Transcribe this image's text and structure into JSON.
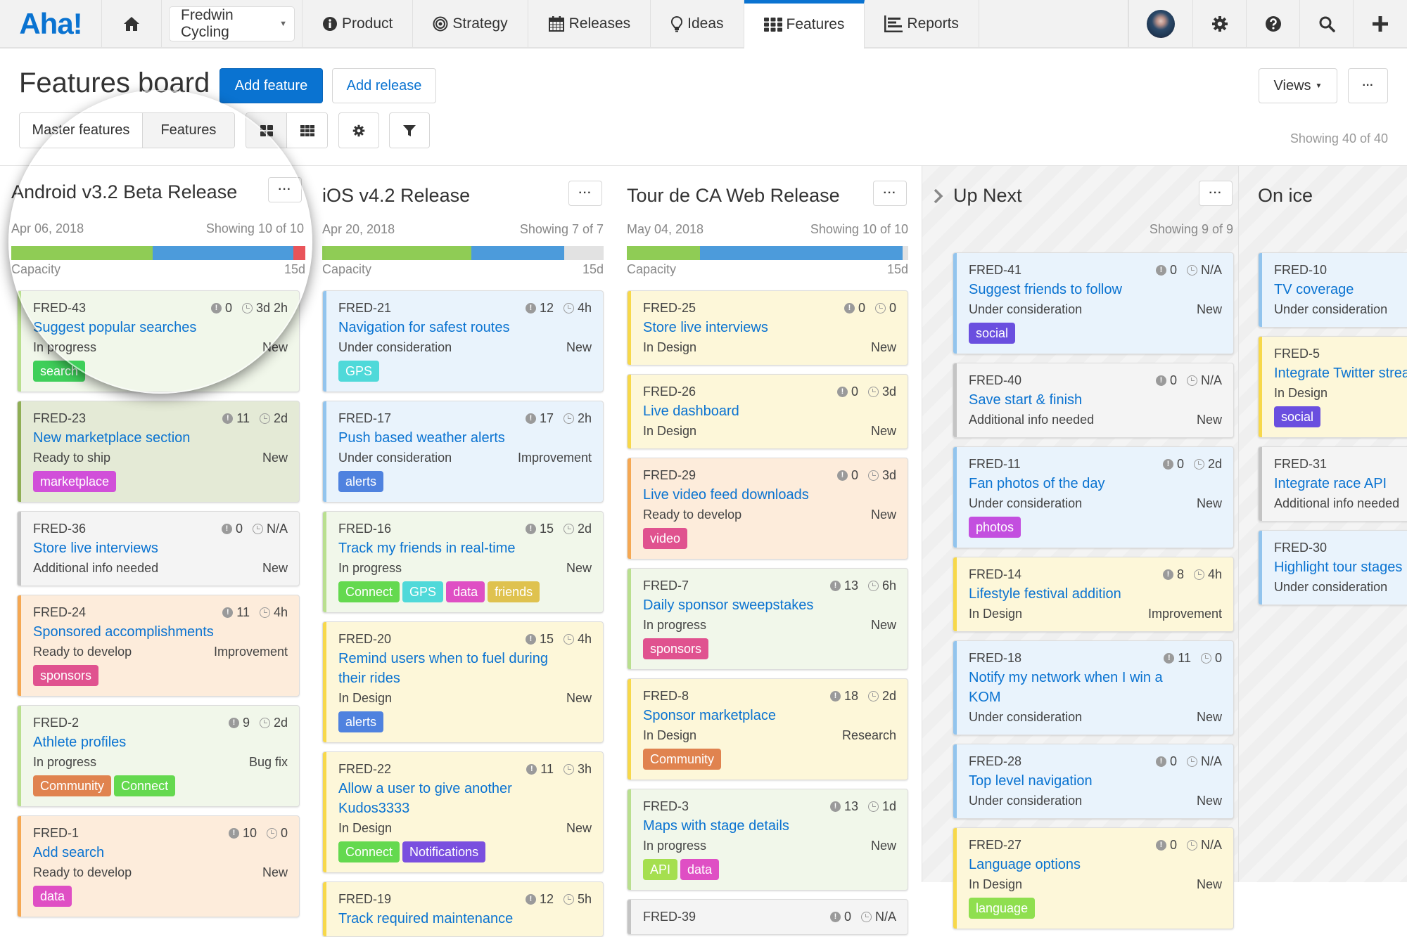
{
  "nav": {
    "logo": "Aha!",
    "product_select": "Fredwin Cycling",
    "tabs": [
      {
        "label": "Product",
        "icon": "info-circle-icon"
      },
      {
        "label": "Strategy",
        "icon": "target-icon"
      },
      {
        "label": "Releases",
        "icon": "calendar-icon"
      },
      {
        "label": "Ideas",
        "icon": "lightbulb-icon"
      },
      {
        "label": "Features",
        "icon": "grid-icon",
        "active": true
      },
      {
        "label": "Reports",
        "icon": "report-icon"
      }
    ]
  },
  "header": {
    "title": "Features board",
    "add_feature": "Add feature",
    "add_release": "Add release",
    "views": "Views",
    "more": "···",
    "toggle": [
      "Master features",
      "Features"
    ],
    "showing": "Showing 40 of 40"
  },
  "colors": {
    "accent": "#0a73d1",
    "capacity_done": "#8fcc55",
    "capacity_planned": "#4c9bdb",
    "capacity_over": "#e9545a"
  },
  "columns": [
    {
      "title": "Android v3.2 Beta Release",
      "date": "Apr 06, 2018",
      "showing": "Showing 10 of 10",
      "capacity_label": "Capacity",
      "capacity_value": "15d",
      "capacity": {
        "done": 0.48,
        "planned": 0.48,
        "over": 0.04
      },
      "cards": [
        {
          "id": "FRED-43",
          "title": [
            "Suggest popular searches"
          ],
          "status": "In progress",
          "type": "New",
          "score": "0",
          "time": "3d 2h",
          "color": "green",
          "tags": [
            {
              "label": "search",
              "color": "#3fcf5a"
            }
          ]
        },
        {
          "id": "FRED-23",
          "title": [
            "New marketplace section"
          ],
          "status": "Ready to ship",
          "type": "New",
          "score": "11",
          "time": "2d",
          "color": "olive",
          "tags": [
            {
              "label": "marketplace",
              "color": "#d14fd9"
            }
          ]
        },
        {
          "id": "FRED-36",
          "title": [
            "Store live interviews"
          ],
          "status": "Additional info needed",
          "type": "New",
          "score": "0",
          "time": "N/A",
          "color": "gray",
          "tags": []
        },
        {
          "id": "FRED-24",
          "title": [
            "Sponsored accomplishments"
          ],
          "status": "Ready to develop",
          "type": "Improvement",
          "score": "11",
          "time": "4h",
          "color": "orange",
          "tags": [
            {
              "label": "sponsors",
              "color": "#e0528f"
            }
          ]
        },
        {
          "id": "FRED-2",
          "title": [
            "Athlete profiles"
          ],
          "status": "In progress",
          "type": "Bug fix",
          "score": "9",
          "time": "2d",
          "color": "green",
          "tags": [
            {
              "label": "Community",
              "color": "#e0834f"
            },
            {
              "label": "Connect",
              "color": "#64d94f"
            }
          ]
        },
        {
          "id": "FRED-1",
          "title": [
            "Add search"
          ],
          "status": "Ready to develop",
          "type": "New",
          "score": "10",
          "time": "0",
          "color": "orange",
          "tags": [
            {
              "label": "data",
              "color": "#df4fc4"
            }
          ]
        }
      ]
    },
    {
      "title": "iOS v4.2 Release",
      "date": "Apr 20, 2018",
      "showing": "Showing 7 of 7",
      "capacity_label": "Capacity",
      "capacity_value": "15d",
      "capacity": {
        "done": 0.53,
        "planned": 0.33,
        "over": 0
      },
      "cards": [
        {
          "id": "FRED-21",
          "title": [
            "Navigation for safest routes"
          ],
          "status": "Under consideration",
          "type": "New",
          "score": "12",
          "time": "4h",
          "color": "blue",
          "tags": [
            {
              "label": "GPS",
              "color": "#4fd9d9"
            }
          ]
        },
        {
          "id": "FRED-17",
          "title": [
            "Push based weather alerts"
          ],
          "status": "Under consideration",
          "type": "Improvement",
          "score": "17",
          "time": "2h",
          "color": "blue",
          "tags": [
            {
              "label": "alerts",
              "color": "#4f82df"
            }
          ]
        },
        {
          "id": "FRED-16",
          "title": [
            "Track my friends in real-time"
          ],
          "status": "In progress",
          "type": "New",
          "score": "15",
          "time": "2d",
          "color": "green",
          "tags": [
            {
              "label": "Connect",
              "color": "#64d94f"
            },
            {
              "label": "GPS",
              "color": "#4fd9d9"
            },
            {
              "label": "data",
              "color": "#df4fc4"
            },
            {
              "label": "friends",
              "color": "#dfc24f"
            }
          ]
        },
        {
          "id": "FRED-20",
          "title": [
            "Remind users when to fuel during",
            "their rides"
          ],
          "status": "In Design",
          "type": "New",
          "score": "15",
          "time": "4h",
          "color": "yellow",
          "tags": [
            {
              "label": "alerts",
              "color": "#4f82df"
            }
          ]
        },
        {
          "id": "FRED-22",
          "title": [
            "Allow a user to give another",
            "Kudos3333"
          ],
          "status": "In Design",
          "type": "New",
          "score": "11",
          "time": "3h",
          "color": "yellow",
          "tags": [
            {
              "label": "Connect",
              "color": "#64d94f"
            },
            {
              "label": "Notifications",
              "color": "#7a4fdf"
            }
          ]
        },
        {
          "id": "FRED-19",
          "title": [
            "Track required maintenance"
          ],
          "status": "",
          "type": "",
          "score": "12",
          "time": "5h",
          "color": "yellow",
          "tags": []
        }
      ]
    },
    {
      "title": "Tour de CA Web Release",
      "date": "May 04, 2018",
      "showing": "Showing 10 of 10",
      "capacity_label": "Capacity",
      "capacity_value": "15d",
      "capacity": {
        "done": 0.26,
        "planned": 0.72,
        "over": 0
      },
      "cards": [
        {
          "id": "FRED-25",
          "title": [
            "Store live interviews"
          ],
          "status": "In Design",
          "type": "New",
          "score": "0",
          "time": "0",
          "color": "yellow",
          "tags": []
        },
        {
          "id": "FRED-26",
          "title": [
            "Live dashboard"
          ],
          "status": "In Design",
          "type": "New",
          "score": "0",
          "time": "3d",
          "color": "yellow",
          "tags": []
        },
        {
          "id": "FRED-29",
          "title": [
            "Live video feed downloads"
          ],
          "status": "Ready to develop",
          "type": "New",
          "score": "0",
          "time": "3d",
          "color": "orange",
          "tags": [
            {
              "label": "video",
              "color": "#e0528f"
            }
          ]
        },
        {
          "id": "FRED-7",
          "title": [
            "Daily sponsor sweepstakes"
          ],
          "status": "In progress",
          "type": "New",
          "score": "13",
          "time": "6h",
          "color": "green",
          "tags": [
            {
              "label": "sponsors",
              "color": "#e0528f"
            }
          ]
        },
        {
          "id": "FRED-8",
          "title": [
            "Sponsor marketplace"
          ],
          "status": "In Design",
          "type": "Research",
          "score": "18",
          "time": "2d",
          "color": "yellow",
          "tags": [
            {
              "label": "Community",
              "color": "#e0834f"
            }
          ]
        },
        {
          "id": "FRED-3",
          "title": [
            "Maps with stage details"
          ],
          "status": "In progress",
          "type": "New",
          "score": "13",
          "time": "1d",
          "color": "green",
          "tags": [
            {
              "label": "API",
              "color": "#a5df4f"
            },
            {
              "label": "data",
              "color": "#df4fc4"
            }
          ]
        },
        {
          "id": "FRED-39",
          "title": [],
          "status": "",
          "type": "",
          "score": "0",
          "time": "N/A",
          "color": "gray",
          "tags": []
        }
      ]
    },
    {
      "title": "Up Next",
      "showing": "Showing 9 of 9",
      "cards": [
        {
          "id": "FRED-41",
          "title": [
            "Suggest friends to follow"
          ],
          "status": "Under consideration",
          "type": "New",
          "score": "0",
          "time": "N/A",
          "color": "blue",
          "tags": [
            {
              "label": "social",
              "color": "#6a4fdf"
            }
          ]
        },
        {
          "id": "FRED-40",
          "title": [
            "Save start & finish"
          ],
          "status": "Additional info needed",
          "type": "New",
          "score": "0",
          "time": "N/A",
          "color": "gray",
          "tags": []
        },
        {
          "id": "FRED-11",
          "title": [
            "Fan photos of the day"
          ],
          "status": "Under consideration",
          "type": "New",
          "score": "0",
          "time": "2d",
          "color": "blue",
          "tags": [
            {
              "label": "photos",
              "color": "#c34fdf"
            }
          ]
        },
        {
          "id": "FRED-14",
          "title": [
            "Lifestyle festival addition"
          ],
          "status": "In Design",
          "type": "Improvement",
          "score": "8",
          "time": "4h",
          "color": "yellow",
          "tags": []
        },
        {
          "id": "FRED-18",
          "title": [
            "Notify my network when I win a",
            "KOM"
          ],
          "status": "Under consideration",
          "type": "New",
          "score": "11",
          "time": "0",
          "color": "blue",
          "tags": []
        },
        {
          "id": "FRED-28",
          "title": [
            "Top level navigation"
          ],
          "status": "Under consideration",
          "type": "New",
          "score": "0",
          "time": "N/A",
          "color": "blue",
          "tags": []
        },
        {
          "id": "FRED-27",
          "title": [
            "Language options"
          ],
          "status": "In Design",
          "type": "New",
          "score": "0",
          "time": "N/A",
          "color": "yellow",
          "tags": [
            {
              "label": "language",
              "color": "#8fdf4f"
            }
          ]
        }
      ]
    },
    {
      "title": "On ice",
      "cards": [
        {
          "id": "FRED-10",
          "title": [
            "TV coverage"
          ],
          "status": "Under consideration",
          "color": "blue",
          "tags": []
        },
        {
          "id": "FRED-5",
          "title": [
            "Integrate Twitter stream"
          ],
          "status": "In Design",
          "color": "yellow",
          "tags": [
            {
              "label": "social",
              "color": "#6a4fdf"
            }
          ]
        },
        {
          "id": "FRED-31",
          "title": [
            "Integrate race API"
          ],
          "status": "Additional info needed",
          "color": "gray",
          "tags": []
        },
        {
          "id": "FRED-30",
          "title": [
            "Highlight tour stages"
          ],
          "status": "Under consideration",
          "color": "blue",
          "tags": []
        }
      ]
    }
  ]
}
